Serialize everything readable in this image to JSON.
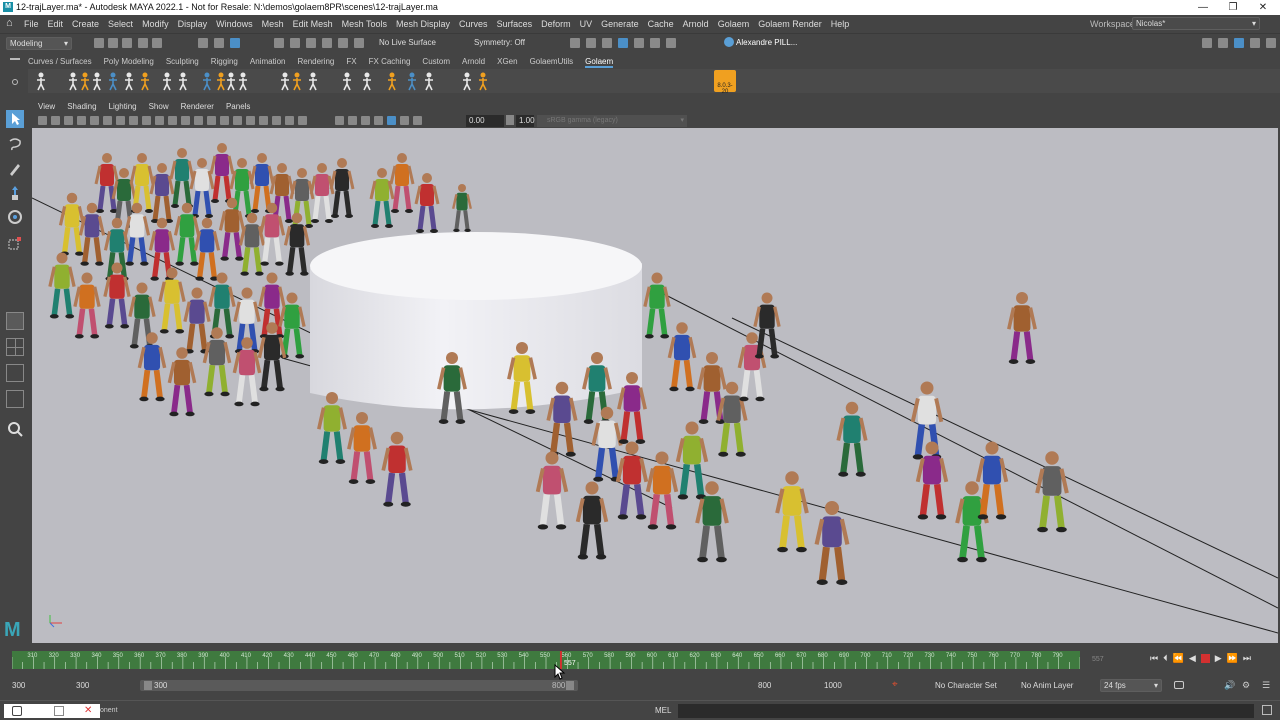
{
  "window": {
    "title": "12-trajLayer.ma* - Autodesk MAYA 2022.1 - Not for Resale: N:\\demos\\golaem8PR\\scenes\\12-trajLayer.ma",
    "controls": [
      "—",
      "❐",
      "✕"
    ]
  },
  "menubar": {
    "items": [
      "File",
      "Edit",
      "Create",
      "Select",
      "Modify",
      "Display",
      "Windows",
      "Mesh",
      "Edit Mesh",
      "Mesh Tools",
      "Mesh Display",
      "Curves",
      "Surfaces",
      "Deform",
      "UV",
      "Generate",
      "Cache",
      "Arnold",
      "Golaem",
      "Golaem Render",
      "Help"
    ],
    "workspace_label": "Workspace:",
    "workspace_value": "Nicolas*"
  },
  "statusline": {
    "mode": "Modeling",
    "live_surface": "No Live Surface",
    "symmetry": "Symmetry: Off",
    "user": "Alexandre PILL..."
  },
  "shelf": {
    "tabs": [
      "Curves / Surfaces",
      "Poly Modeling",
      "Sculpting",
      "Rigging",
      "Animation",
      "Rendering",
      "FX",
      "FX Caching",
      "Custom",
      "Arnold",
      "XGen",
      "GolaemUtils",
      "Golaem"
    ],
    "active_tab": "Golaem",
    "version_badge": "8.0.3-20"
  },
  "panel": {
    "menus": [
      "View",
      "Shading",
      "Lighting",
      "Show",
      "Renderer",
      "Panels"
    ],
    "exposure": "0.00",
    "gamma": "1.00",
    "color_space": "sRGB gamma (legacy)"
  },
  "timeline": {
    "ticks": [
      310,
      320,
      330,
      340,
      350,
      360,
      370,
      380,
      390,
      400,
      410,
      420,
      430,
      440,
      450,
      460,
      470,
      480,
      490,
      500,
      510,
      520,
      530,
      540,
      550,
      560,
      570,
      580,
      590,
      600,
      610,
      620,
      630,
      640,
      650,
      660,
      670,
      680,
      690,
      700,
      710,
      720,
      730,
      740,
      750,
      760,
      770,
      780,
      790
    ],
    "range_start": 300,
    "range_end": 800,
    "current_frame": "557",
    "end_label": "557",
    "start_frame": "300",
    "playback_start": "300",
    "slider_start": "300",
    "slider_end": "800",
    "playback_end": "800",
    "anim_end": "1000",
    "character_set": "No Character Set",
    "anim_layer": "No Anim Layer",
    "fps": "24 fps"
  },
  "commandline": {
    "language": "MEL",
    "partial_text": "onent"
  },
  "colors": {
    "ui_bg": "#444444",
    "viewport_bg": "#bcbcc2",
    "timeline_green": "#3f7a3f",
    "accent_blue": "#5a9fd6",
    "playhead_red": "#d23030"
  }
}
